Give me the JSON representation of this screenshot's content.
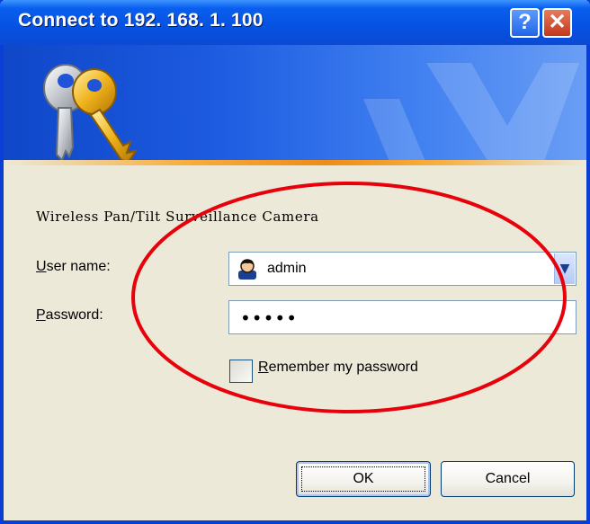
{
  "window": {
    "title": "Connect to 192. 168. 1. 100",
    "help_glyph": "?",
    "close_glyph": "✕"
  },
  "banner": {
    "icon": "keys-icon"
  },
  "dialog": {
    "description": "Wireless Pan/Tilt Surveillance Camera",
    "username_label_accel": "U",
    "username_label_rest": "ser name:",
    "username_value": "admin",
    "password_label_accel": "P",
    "password_label_rest": "assword:",
    "password_value": "•••••",
    "remember_accel": "R",
    "remember_rest": "emember my password",
    "remember_checked": false,
    "ok_label": "OK",
    "cancel_label": "Cancel"
  },
  "annotation": {
    "color": "#e8000a",
    "shape": "ellipse"
  },
  "colors": {
    "titlebar": "#0653e2",
    "dialog_bg": "#ece9d8",
    "accent": "#ef8c14"
  }
}
